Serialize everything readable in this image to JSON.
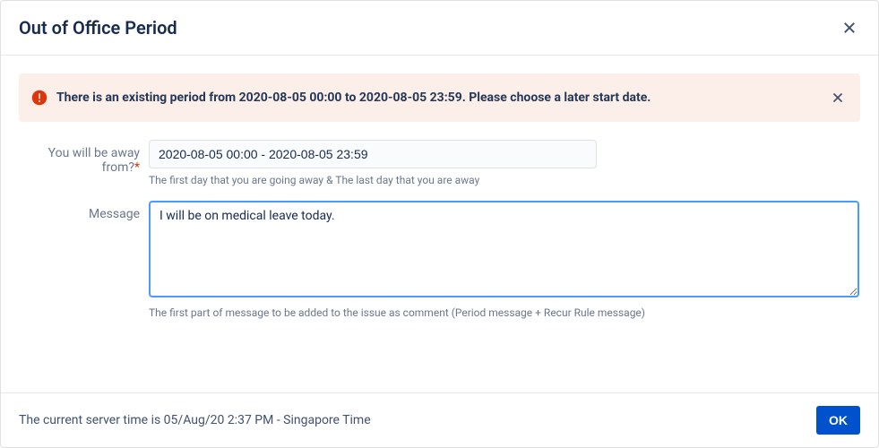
{
  "header": {
    "title": "Out of Office Period"
  },
  "alert": {
    "message": "There is an existing period from 2020-08-05 00:00 to 2020-08-05 23:59. Please choose a later start date."
  },
  "form": {
    "away_label": "You will be away from?",
    "away_value": "2020-08-05 00:00 - 2020-08-05 23:59",
    "away_help": "The first day that you are going away & The last day that you are away",
    "message_label": "Message",
    "message_value": "I will be on medical leave today.",
    "message_help": "The first part of message to be added to the issue as comment (Period message + Recur Rule message)"
  },
  "footer": {
    "server_time": "The current server time is 05/Aug/20 2:37 PM - Singapore Time",
    "ok_label": "OK"
  }
}
